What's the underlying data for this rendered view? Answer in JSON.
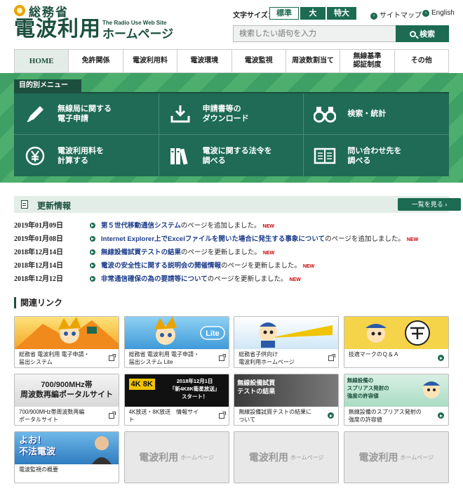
{
  "header": {
    "ministry": "総務省",
    "site_name": "電波利用",
    "site_name_suffix": "ホームページ",
    "subtitle": "The Radio Use Web Site",
    "font_size_label": "文字サイズ：",
    "font_sizes": [
      "標準",
      "大",
      "特大"
    ],
    "sitemap": "サイトマップ",
    "english": "English",
    "search_placeholder": "検索したい語句を入力",
    "search_button": "検索"
  },
  "nav": [
    "HOME",
    "免許関係",
    "電波利用料",
    "電波環境",
    "電波監視",
    "周波数割当て",
    "無線基準\n認証制度",
    "その他"
  ],
  "purpose_menu": {
    "title": "目的別メニュー",
    "items": [
      {
        "label": "無線局に関する\n電子申請",
        "icon": "pen-icon"
      },
      {
        "label": "申請書等の\nダウンロード",
        "icon": "download-icon"
      },
      {
        "label": "検索・統計",
        "icon": "binoculars-icon"
      },
      {
        "label": "電波利用料を\n計算する",
        "icon": "yen-icon"
      },
      {
        "label": "電波に関する法令を\n調べる",
        "icon": "books-icon"
      },
      {
        "label": "問い合わせ先を\n調べる",
        "icon": "book-open-icon"
      }
    ]
  },
  "updates": {
    "title": "更新情報",
    "view_list": "一覧を見る ›",
    "new_badge": "NEW",
    "items": [
      {
        "date": "2019年01月09日",
        "link": "第５世代移動通信システム",
        "rest": "のページを追加しました。"
      },
      {
        "date": "2019年01月08日",
        "link": "Internet Explorer上でExcelファイルを開いた場合に発生する事象について",
        "rest": "のページを追加しました。"
      },
      {
        "date": "2018年12月14日",
        "link": "無線設備試買テストの結果",
        "rest": "のページを更新しました。"
      },
      {
        "date": "2018年12月14日",
        "link": "電波の安全性に関する説明会の開催情報",
        "rest": "のページを更新しました。"
      },
      {
        "date": "2018年12月12日",
        "link": "非常通信確保の為の要請等について",
        "rest": "のページを更新しました。"
      }
    ]
  },
  "related": {
    "title": "関連リンク",
    "placeholder_title": "電波利用",
    "placeholder_sub": "ホームページ",
    "cards": [
      {
        "label": "総務省 電波利用 電子申請・\n届出システム",
        "type": "ext",
        "img": "mascot"
      },
      {
        "label": "総務省 電波利用 電子申請・\n届出システム Lite",
        "type": "ext",
        "img": "lite"
      },
      {
        "label": "総務省子供向け\n電波利用ホームページ",
        "type": "ext",
        "img": "kids"
      },
      {
        "label": "技適マークのＱ＆Ａ",
        "type": "arrow",
        "img": "giteki"
      },
      {
        "label": "700/900MHz帯周波数再編\nポータルサイト",
        "type": "ext",
        "img": "portal",
        "img_text": "700/900MHz帯\n周波数再編ポータルサイト"
      },
      {
        "label": "4K放送・8K放送　情報サイ\nト",
        "type": "ext",
        "img": "4k8k",
        "img_text": "2018年12月1日\n「新4K8K衛星放送」\nスタート！"
      },
      {
        "label": "無線設備試買テストの結果に\nついて",
        "type": "arrow",
        "img": "test",
        "img_text": "無線設備試買\nテストの結果"
      },
      {
        "label": "無線設備のスプリアス発射の\n強度の許容値",
        "type": "arrow",
        "img": "spurious",
        "img_text": "無線設備の\nスプリアス発射の\n強度の許容値"
      },
      {
        "label": "電波監視の概要",
        "type": "arrow",
        "img": "monitor",
        "img_text": "よお！\n不法電波"
      },
      {
        "label": "",
        "type": "placeholder"
      },
      {
        "label": "",
        "type": "placeholder"
      },
      {
        "label": "",
        "type": "placeholder"
      }
    ]
  }
}
